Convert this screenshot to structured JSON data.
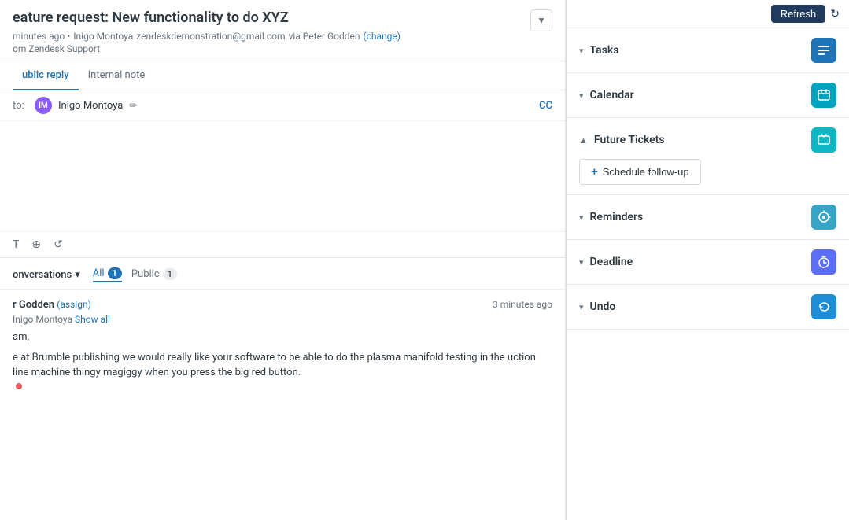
{
  "header": {
    "refresh_label": "Refresh",
    "dropdown_symbol": "▾"
  },
  "ticket": {
    "title": "eature request: New functionality to do XYZ",
    "meta_time": "minutes ago •",
    "meta_author": "Inigo Montoya",
    "meta_email": "zendeskdemonstration@gmail.com",
    "meta_via": "via Peter Godden",
    "meta_change": "(change)",
    "meta_source": "om Zendesk Support"
  },
  "reply": {
    "tab_public": "ublic reply",
    "tab_internal": "Internal note",
    "to_label": "to:",
    "recipient_name": "Inigo Montoya",
    "cc_label": "CC",
    "compose_placeholder": ""
  },
  "toolbar": {
    "text_icon": "T",
    "attach_icon": "⊕",
    "refresh_icon": "↺"
  },
  "conversations": {
    "label": "onversations",
    "chevron": "▾",
    "tab_all": "All",
    "tab_all_count": "1",
    "tab_public": "Public",
    "tab_public_count": "1"
  },
  "conv_entry": {
    "name_prefix": "r Godden",
    "assign_label": "(assign)",
    "sub_name": "Inigo Montoya",
    "show_all": "Show all",
    "time": "3 minutes ago",
    "greeting": "am,",
    "body": "e at Brumble publishing we would really like your software to be able to do the plasma manifold testing in the uction line machine thingy magiggy when you press the big red button."
  },
  "sidebar": {
    "sections": [
      {
        "id": "tasks",
        "label": "Tasks",
        "chevron": "▾",
        "icon_symbol": "☰",
        "icon_class": "icon-blue",
        "collapsed": true
      },
      {
        "id": "calendar",
        "label": "Calendar",
        "chevron": "▾",
        "icon_symbol": "▦",
        "icon_class": "icon-teal",
        "collapsed": true
      },
      {
        "id": "future-tickets",
        "label": "Future Tickets",
        "chevron": "▲",
        "icon_symbol": "⧉",
        "icon_class": "icon-cyan",
        "collapsed": false,
        "schedule_btn": "+ Schedule follow-up"
      },
      {
        "id": "reminders",
        "label": "Reminders",
        "chevron": "▾",
        "icon_symbol": "⊕",
        "icon_class": "icon-sky",
        "collapsed": true
      },
      {
        "id": "deadline",
        "label": "Deadline",
        "chevron": "▾",
        "icon_symbol": "♿",
        "icon_class": "icon-indigo",
        "collapsed": true
      },
      {
        "id": "undo",
        "label": "Undo",
        "chevron": "▾",
        "icon_symbol": "↺",
        "icon_class": "icon-refresh",
        "collapsed": true
      }
    ]
  }
}
